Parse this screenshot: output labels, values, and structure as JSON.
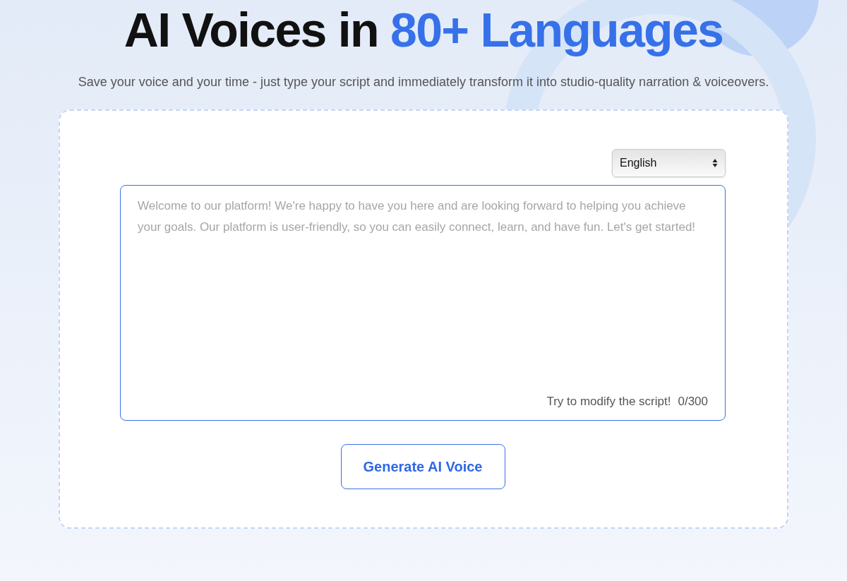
{
  "hero": {
    "title_prefix": "AI Voices in",
    "title_highlight": "80+ Languages",
    "subtitle": "Save your voice and your time - just type your script and immediately transform it into studio-quality narration & voiceovers."
  },
  "editor": {
    "language": "English",
    "script": {
      "placeholder": "Welcome to our platform! We're happy to have you here and are looking forward to helping you achieve your goals. Our platform is user-friendly, so you can easily connect, learn, and have fun. Let's get started!"
    },
    "hint": "Try to modify the script!",
    "counter": "0/300"
  },
  "button": "Generate AI Voice"
}
